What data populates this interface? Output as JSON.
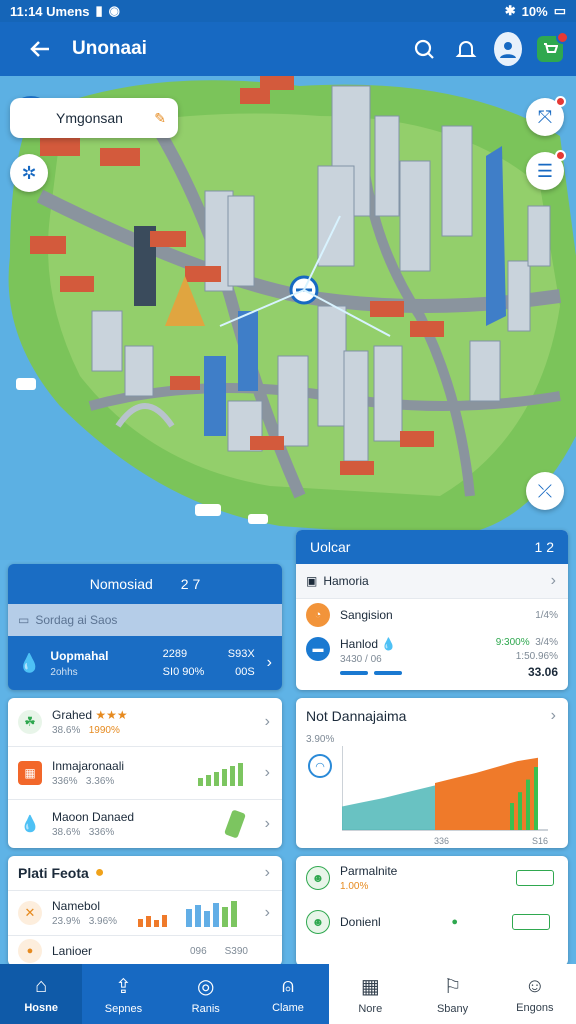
{
  "status": {
    "time": "11:14 Umens",
    "battery": "10%"
  },
  "appbar": {
    "title": "Unonaai"
  },
  "map": {
    "user_name": "Ymgonsan"
  },
  "left_header": {
    "title": "Nomosiad",
    "value": "2 7"
  },
  "left_sub": {
    "label": "Sordag ai Saos"
  },
  "left_stats": {
    "title": "Uopmahal",
    "sub": "2ohhs",
    "v1": "2289",
    "v2": "S93X",
    "v3": "SI0 90%",
    "v4": "00S"
  },
  "list_a": [
    {
      "title": "Grahed",
      "sub1": "38.6%",
      "sub2": "1990%",
      "stars": "★★★"
    },
    {
      "title": "Inmajaronaali",
      "sub1": "336%",
      "sub2": "3.36%"
    },
    {
      "title": "Maoon Danaed",
      "sub1": "38.6%",
      "sub2": "336%"
    }
  ],
  "list_b": {
    "title": "Plati Feota",
    "item_title": "Namebol",
    "item_sub1": "23.9%",
    "item_sub2": "3.96%",
    "item2_title": "Lanioer",
    "item2_v1": "096",
    "item2_v2": "S390"
  },
  "right_header": {
    "title": "Uolcar",
    "value": "1 2"
  },
  "right_list": {
    "section": "Hamoria",
    "r1_title": "Sangision",
    "r1_value": "1/4%",
    "r2_title": "Hanlod",
    "r2_sub": "3430 / 06",
    "r2_v1": "9:300%",
    "r2_v2": "3/4%",
    "r2_v3": "1:50.96%",
    "r2_total": "33.06"
  },
  "chart_card": {
    "title": "Not Dannajaima",
    "sub": "3.90%",
    "x1": "336",
    "x2": "S16"
  },
  "right_list2": [
    {
      "title": "Parmalnite",
      "sub": "1.00%"
    },
    {
      "title": "Donienl"
    }
  ],
  "nav": [
    {
      "label": "Hosne"
    },
    {
      "label": "Sepnes"
    },
    {
      "label": "Ranis"
    },
    {
      "label": "Clame"
    },
    {
      "label": "Nore"
    },
    {
      "label": "Sbany"
    },
    {
      "label": "Engons"
    }
  ],
  "chart_data": {
    "type": "area",
    "series": [
      {
        "values": [
          0.28,
          0.33,
          0.38,
          0.44,
          0.5,
          0.56
        ]
      },
      {
        "values": [
          0.56,
          0.62,
          0.68,
          0.75,
          0.82,
          0.86
        ]
      }
    ],
    "colors": {
      "teal": "#4fb7b7",
      "orange": "#ef7a2a",
      "green": "#3bbf4f"
    }
  }
}
